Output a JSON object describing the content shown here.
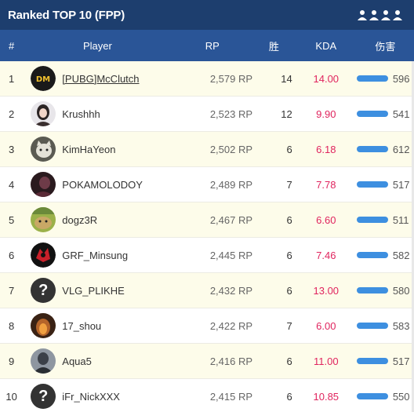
{
  "title": "Ranked TOP 10 (FPP)",
  "mode_icon": "squad-icon",
  "colors": {
    "title_bar": "#1d3e6e",
    "header": "#2a5597",
    "kda": "#e0245e",
    "damage_bar": "#3d8fe0",
    "highlight_row": "#fdfcea"
  },
  "columns": {
    "rank": "#",
    "player": "Player",
    "rp": "RP",
    "wins": "胜",
    "kda": "KDA",
    "damage": "伤害"
  },
  "rows": [
    {
      "rank": "1",
      "name": "[PUBG]McClutch",
      "rp": "2,579 RP",
      "wins": "14",
      "kda": "14.00",
      "damage": "596",
      "avatar": "avatar-gold",
      "link": true
    },
    {
      "rank": "2",
      "name": "Krushhh",
      "rp": "2,523 RP",
      "wins": "12",
      "kda": "9.90",
      "damage": "541",
      "avatar": "avatar-woman"
    },
    {
      "rank": "3",
      "name": "KimHaYeon",
      "rp": "2,502 RP",
      "wins": "6",
      "kda": "6.18",
      "damage": "612",
      "avatar": "avatar-cat"
    },
    {
      "rank": "4",
      "name": "POKAMOLODOY",
      "rp": "2,489 RP",
      "wins": "7",
      "kda": "7.78",
      "damage": "517",
      "avatar": "avatar-dark"
    },
    {
      "rank": "5",
      "name": "dogz3R",
      "rp": "2,467 RP",
      "wins": "6",
      "kda": "6.60",
      "damage": "511",
      "avatar": "avatar-dog"
    },
    {
      "rank": "6",
      "name": "GRF_Minsung",
      "rp": "2,445 RP",
      "wins": "6",
      "kda": "7.46",
      "damage": "582",
      "avatar": "avatar-grf"
    },
    {
      "rank": "7",
      "name": "VLG_PLIKHE",
      "rp": "2,432 RP",
      "wins": "6",
      "kda": "13.00",
      "damage": "580",
      "avatar": "avatar-question"
    },
    {
      "rank": "8",
      "name": "17_shou",
      "rp": "2,422 RP",
      "wins": "7",
      "kda": "6.00",
      "damage": "583",
      "avatar": "avatar-fire"
    },
    {
      "rank": "9",
      "name": "Aqua5",
      "rp": "2,416 RP",
      "wins": "6",
      "kda": "11.00",
      "damage": "517",
      "avatar": "avatar-soldier"
    },
    {
      "rank": "10",
      "name": "iFr_NickXXX",
      "rp": "2,415 RP",
      "wins": "6",
      "kda": "10.85",
      "damage": "550",
      "avatar": "avatar-question"
    }
  ]
}
